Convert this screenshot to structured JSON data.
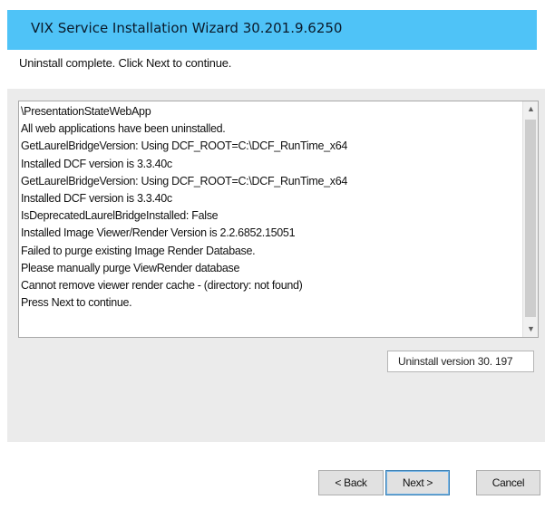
{
  "window": {
    "title": "VIX Service Installation Wizard 30.201.9.6250"
  },
  "header": {
    "subtitle": "Uninstall complete. Click Next to continue."
  },
  "log": {
    "lines": [
      "\\PresentationStateWebApp",
      "All web applications have been uninstalled.",
      "GetLaurelBridgeVersion: Using DCF_ROOT=C:\\DCF_RunTime_x64",
      "Installed DCF version is 3.3.40c",
      "GetLaurelBridgeVersion: Using DCF_ROOT=C:\\DCF_RunTime_x64",
      "Installed DCF version is 3.3.40c",
      "IsDeprecatedLaurelBridgeInstalled: False",
      "Installed Image Viewer/Render Version is 2.2.6852.15051",
      "Failed to purge existing Image Render Database.",
      "Please manually purge ViewRender database",
      "Cannot remove viewer render cache - (directory:  not found)",
      "Press Next to continue."
    ],
    "scroll_up_icon": "scroll-up-arrow",
    "scroll_down_icon": "scroll-down-arrow"
  },
  "version_label": "Uninstall version 30. 197",
  "buttons": {
    "back": "< Back",
    "next": "Next >",
    "cancel": "Cancel"
  }
}
